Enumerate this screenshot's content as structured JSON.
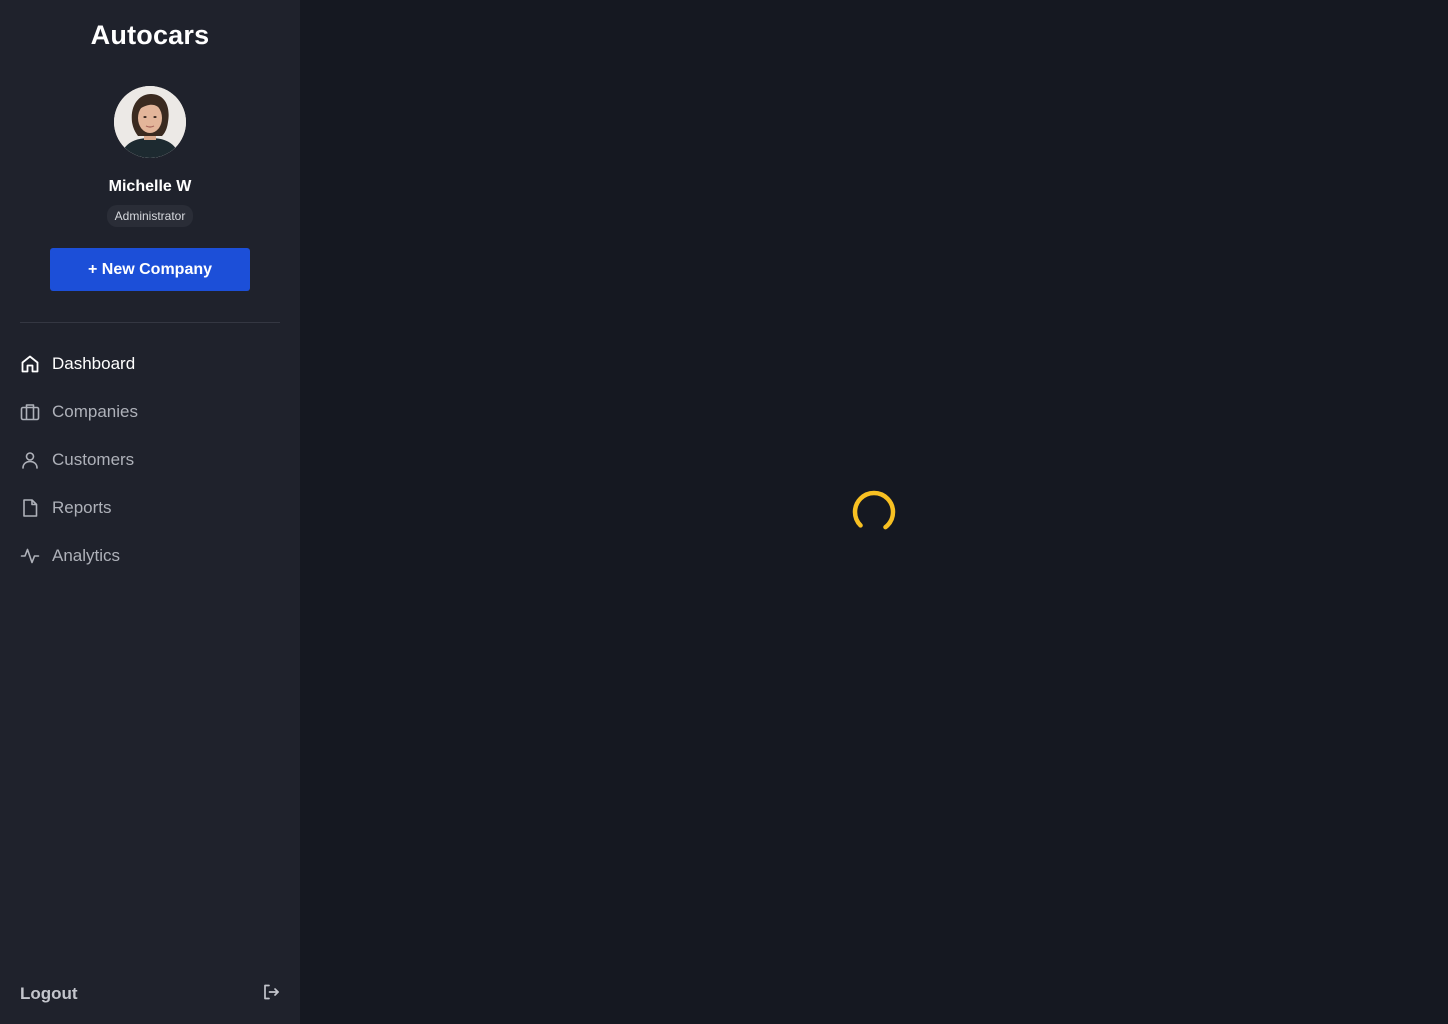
{
  "app": {
    "brand": "Autocars"
  },
  "user": {
    "name": "Michelle W",
    "role": "Administrator"
  },
  "actions": {
    "new_company_label": "+ New Company"
  },
  "nav": {
    "items": [
      {
        "label": "Dashboard",
        "icon": "home-icon",
        "active": true
      },
      {
        "label": "Companies",
        "icon": "briefcase-icon",
        "active": false
      },
      {
        "label": "Customers",
        "icon": "user-icon",
        "active": false
      },
      {
        "label": "Reports",
        "icon": "document-icon",
        "active": false
      },
      {
        "label": "Analytics",
        "icon": "activity-icon",
        "active": false
      }
    ]
  },
  "footer": {
    "logout_label": "Logout",
    "logout_icon": "logout-icon"
  },
  "main": {
    "state": "loading",
    "spinner_icon": "loading-spinner-icon"
  },
  "colors": {
    "background": "#151821",
    "sidebar": "#1f222c",
    "primary_button": "#1c4fd8",
    "spinner": "#f8c022"
  }
}
